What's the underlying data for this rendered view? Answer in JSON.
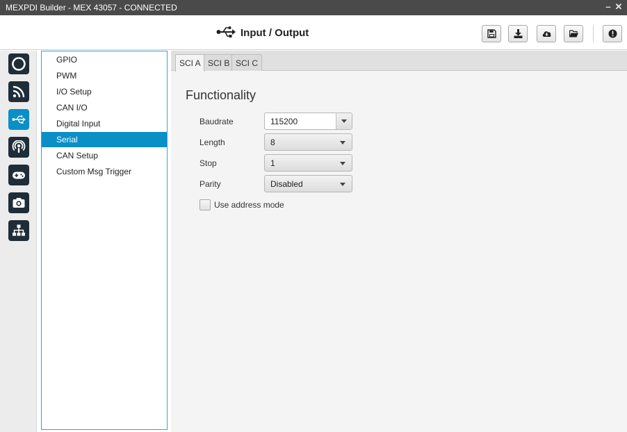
{
  "window": {
    "title": "MEXPDI Builder - MEX 43057 - CONNECTED",
    "minimize_glyph": "–",
    "close_glyph": "✕"
  },
  "header": {
    "title": "Input / Output",
    "icon": "usb-icon",
    "toolbar": [
      {
        "name": "save",
        "icon": "floppy-icon"
      },
      {
        "name": "download",
        "icon": "download-icon"
      },
      {
        "name": "cloud-download",
        "icon": "cloud-download-icon"
      },
      {
        "name": "open-folder",
        "icon": "folder-open-icon"
      },
      {
        "name": "info",
        "icon": "exclamation-icon"
      }
    ]
  },
  "rail": {
    "items": [
      {
        "icon": "circle-icon",
        "active": false
      },
      {
        "icon": "rss-icon",
        "active": false
      },
      {
        "icon": "usb-icon",
        "active": true
      },
      {
        "icon": "podcast-icon",
        "active": false
      },
      {
        "icon": "gamepad-icon",
        "active": false
      },
      {
        "icon": "camera-icon",
        "active": false
      },
      {
        "icon": "sitemap-icon",
        "active": false
      }
    ]
  },
  "nav": {
    "items": [
      {
        "label": "GPIO"
      },
      {
        "label": "PWM"
      },
      {
        "label": "I/O Setup"
      },
      {
        "label": "CAN I/O"
      },
      {
        "label": "Digital Input"
      },
      {
        "label": "Serial"
      },
      {
        "label": "CAN Setup"
      },
      {
        "label": "Custom Msg Trigger"
      }
    ],
    "selected": "Serial"
  },
  "tabs": [
    {
      "label": "SCI A"
    },
    {
      "label": "SCI B"
    },
    {
      "label": "SCI C"
    }
  ],
  "active_tab": "SCI A",
  "functionality": {
    "title": "Functionality",
    "baudrate": {
      "label": "Baudrate",
      "value": "115200"
    },
    "length": {
      "label": "Length",
      "value": "8"
    },
    "stop": {
      "label": "Stop",
      "value": "1"
    },
    "parity": {
      "label": "Parity",
      "value": "Disabled"
    },
    "address_mode": {
      "label": "Use address mode",
      "checked": false
    }
  },
  "colors": {
    "accent": "#0a8fc7",
    "rail_button": "#1f2d38",
    "titlebar": "#4a4a4a"
  }
}
